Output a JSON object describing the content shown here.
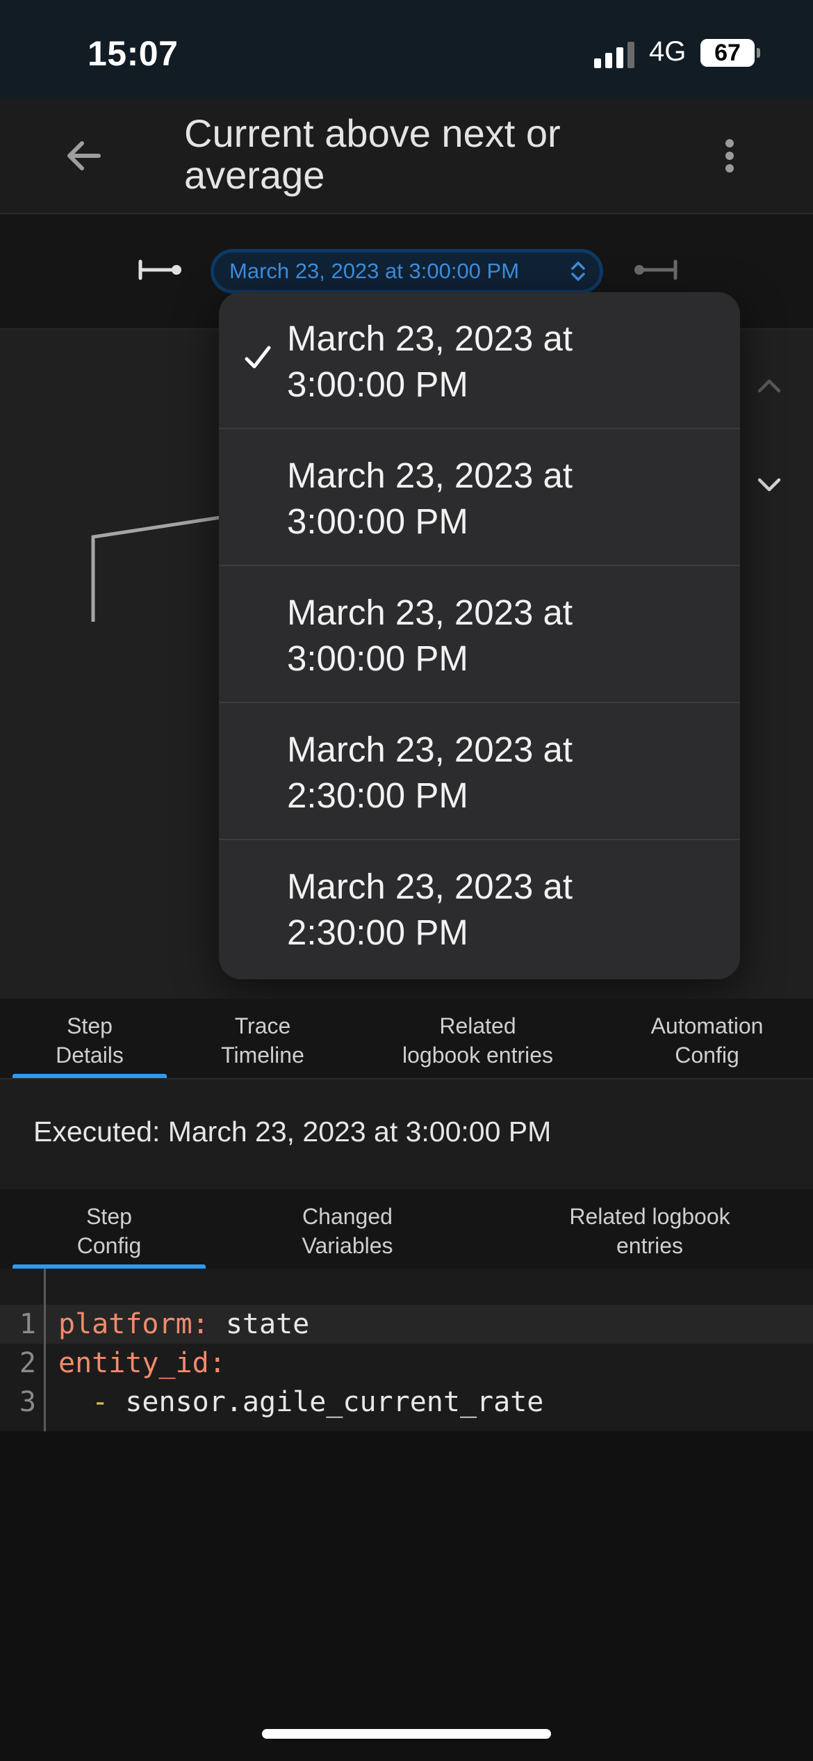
{
  "status_bar": {
    "time": "15:07",
    "network": "4G",
    "battery": "67",
    "battery_level": 0.67
  },
  "header": {
    "title": "Current above next or average",
    "back_icon": "arrow-left-icon",
    "menu_icon": "dots-vertical-icon"
  },
  "trace_nav": {
    "selected": "March 23, 2023 at 3:00:00 PM",
    "prev_icon": "arrow-collapse-left-icon",
    "next_icon": "arrow-collapse-right-icon"
  },
  "dropdown": {
    "items": [
      {
        "line1": "March 23, 2023 at",
        "line2": "3:00:00 PM",
        "checked": true
      },
      {
        "line1": "March 23, 2023 at",
        "line2": "3:00:00 PM",
        "checked": false
      },
      {
        "line1": "March 23, 2023 at",
        "line2": "3:00:00 PM",
        "checked": false
      },
      {
        "line1": "March 23, 2023 at",
        "line2": "2:30:00 PM",
        "checked": false
      },
      {
        "line1": "March 23, 2023 at",
        "line2": "2:30:00 PM",
        "checked": false
      }
    ]
  },
  "tabs": {
    "main": [
      {
        "line1": "Step",
        "line2": "Details",
        "active": true
      },
      {
        "line1": "Trace",
        "line2": "Timeline",
        "active": false
      },
      {
        "line1": "Related",
        "line2": "logbook entries",
        "active": false
      },
      {
        "line1": "Automation",
        "line2": "Config",
        "active": false
      }
    ],
    "sub": [
      {
        "line1": "Step",
        "line2": "Config",
        "active": true
      },
      {
        "line1": "Changed",
        "line2": "Variables",
        "active": false
      },
      {
        "line1": "Related logbook",
        "line2": "entries",
        "active": false
      }
    ]
  },
  "executed": "Executed: March 23, 2023 at 3:00:00 PM",
  "code": {
    "lines": [
      {
        "no": "1",
        "key": "platform:",
        "value": " state"
      },
      {
        "no": "2",
        "key": "entity_id:",
        "value": ""
      },
      {
        "no": "3",
        "dash": "  - ",
        "value": "sensor.agile_current_rate"
      }
    ]
  },
  "colors": {
    "accent": "#2d9bf0",
    "select_text": "#3d8fe0",
    "yaml_key": "#f28b6c",
    "yaml_dash": "#e5b84b"
  }
}
